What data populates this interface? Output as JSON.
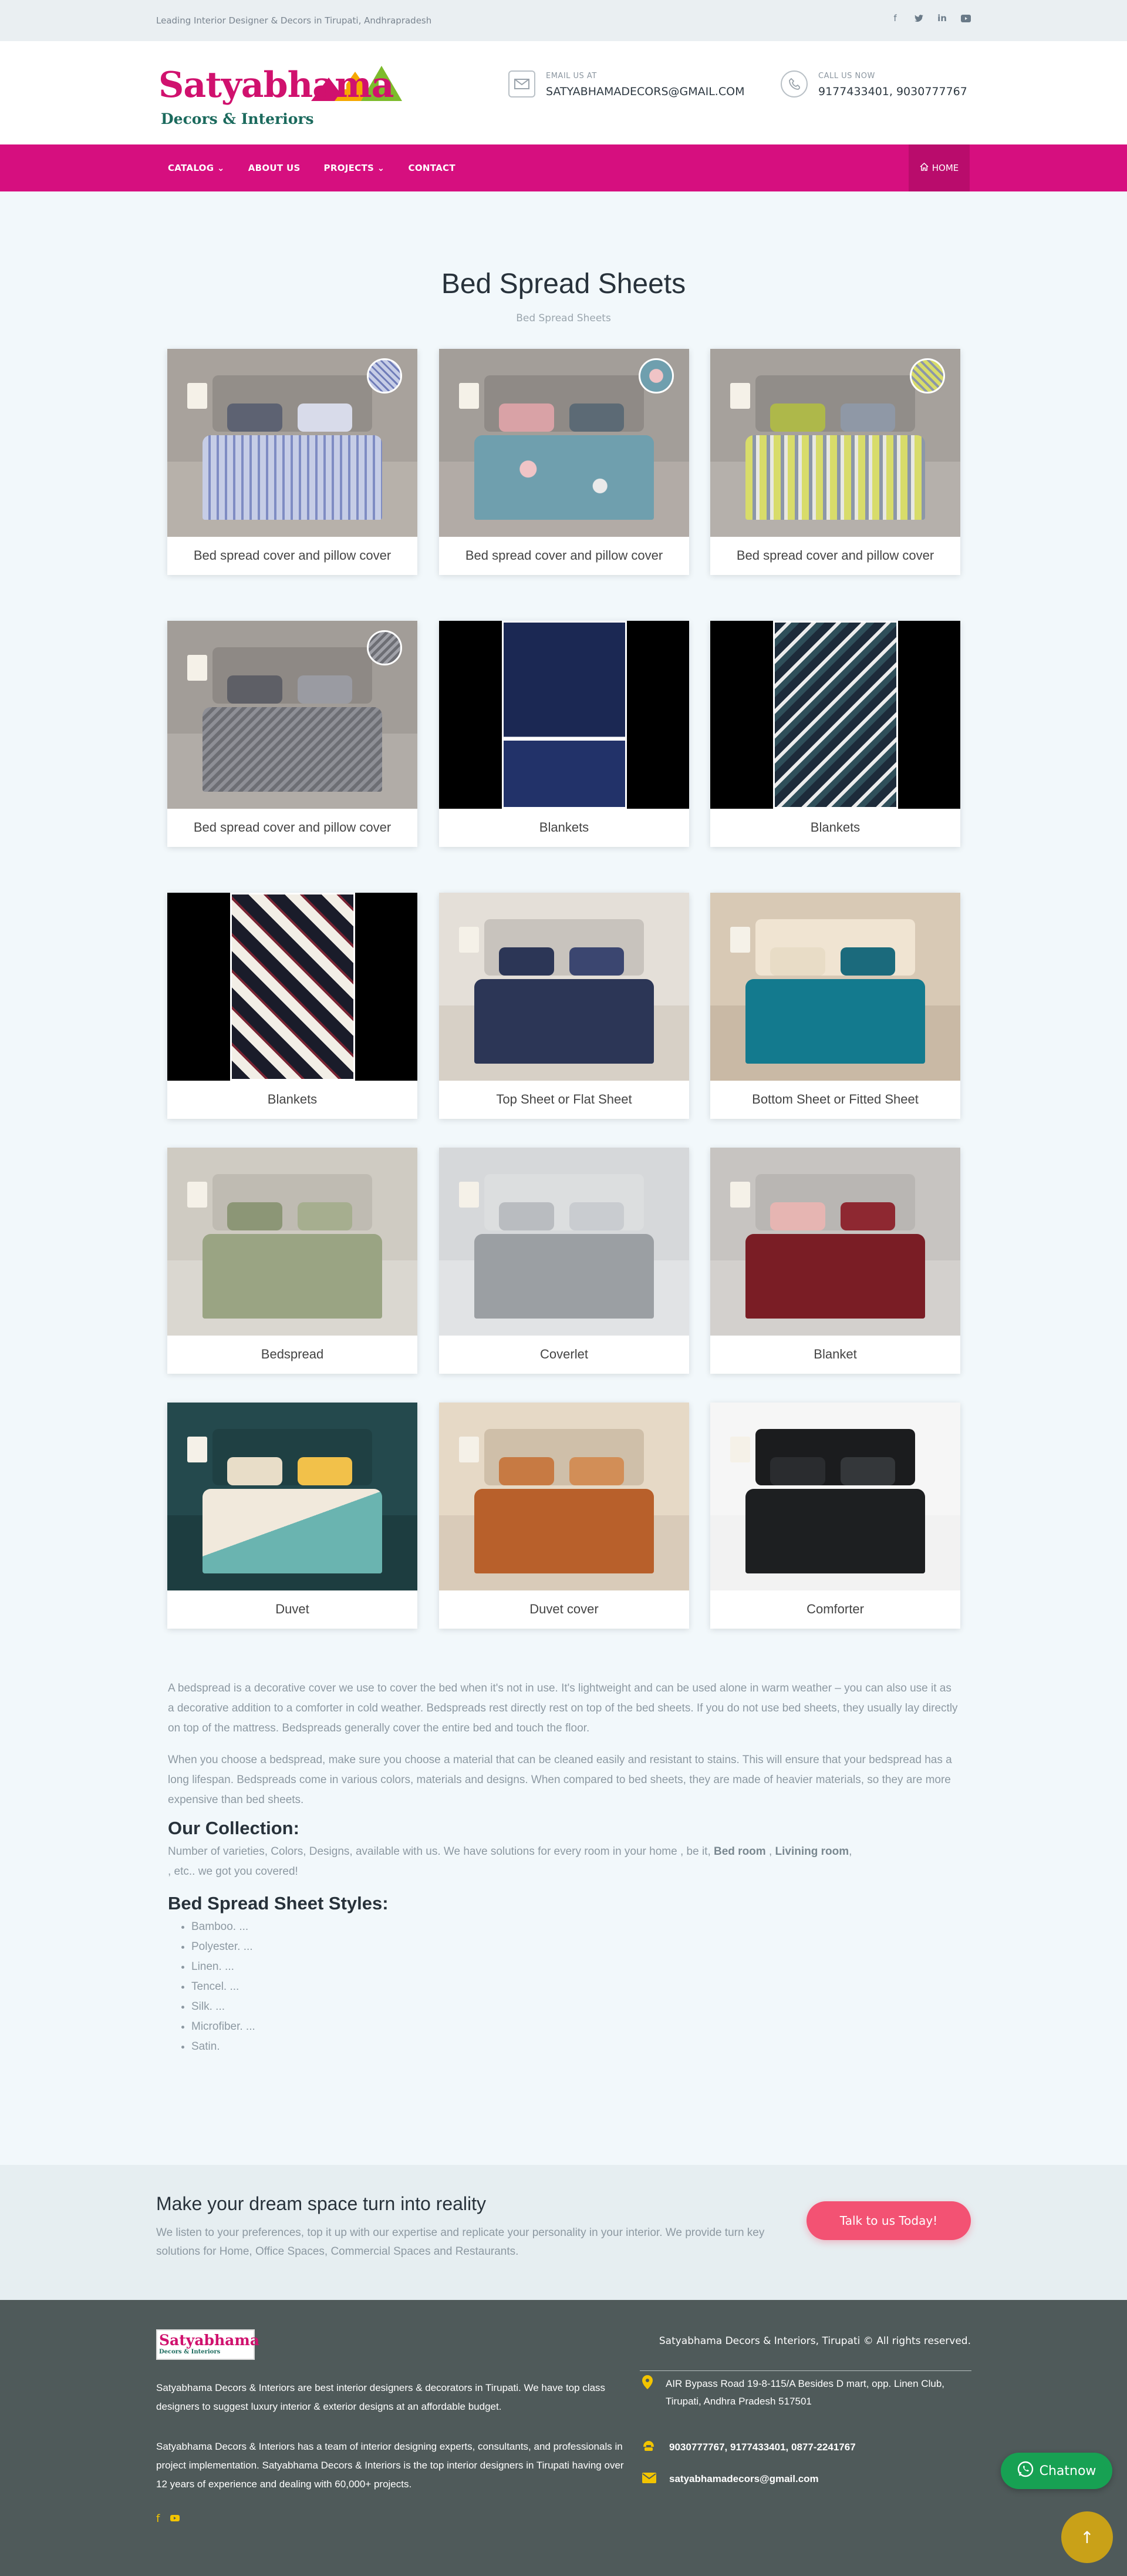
{
  "topbar": {
    "tagline": "Leading Interior Designer & Decors in Tirupati, Andhrapradesh",
    "social": [
      "facebook-icon",
      "twitter-icon",
      "linkedin-icon",
      "youtube-icon"
    ]
  },
  "header": {
    "logo_main": "Satyabhama",
    "logo_sub": "Decors & Interiors",
    "email_label": "EMAIL US AT",
    "email_value": "SATYABHAMADECORS@GMAIL.COM",
    "call_label": "CALL US NOW",
    "call_value": "9177433401, 9030777767"
  },
  "nav": {
    "items": [
      "CATALOG",
      "ABOUT US",
      "PROJECTS",
      "CONTACT"
    ],
    "home_label": "HOME",
    "color": "#d60f7f"
  },
  "page": {
    "title": "Bed Spread Sheets",
    "subtitle": "Bed Spread Sheets"
  },
  "products": [
    {
      "caption": "Bed spread cover and pillow cover",
      "style": "stripe-lilac"
    },
    {
      "caption": "Bed spread cover and pillow cover",
      "style": "floral-blue"
    },
    {
      "caption": "Bed spread cover and pillow cover",
      "style": "stripe-yellow"
    },
    {
      "caption": "Bed spread cover and pillow cover",
      "style": "grey-wave"
    },
    {
      "caption": "Blankets",
      "style": "blanket-navy"
    },
    {
      "caption": "Blankets",
      "style": "blanket-chevron"
    },
    {
      "caption": "Blankets",
      "style": "blanket-geo"
    },
    {
      "caption": "Top Sheet or Flat Sheet",
      "style": "flat-navy"
    },
    {
      "caption": "Bottom Sheet or Fitted Sheet",
      "style": "fitted-teal"
    },
    {
      "caption": "Bedspread",
      "style": "bedspread-olive"
    },
    {
      "caption": "Coverlet",
      "style": "coverlet-grey"
    },
    {
      "caption": "Blanket",
      "style": "blanket-maroon"
    },
    {
      "caption": "Duvet",
      "style": "duvet-teal"
    },
    {
      "caption": "Duvet cover",
      "style": "duvet-rust"
    },
    {
      "caption": "Comforter",
      "style": "comforter-black"
    }
  ],
  "description": {
    "para1": "A bedspread is a decorative cover we use to cover the bed when it's not in use. It's lightweight and can be used alone in warm weather – you can also use it as a decorative addition to a comforter in cold weather. Bedspreads rest directly rest on top of the bed sheets. If you do not use bed sheets, they usually lay directly on top of the mattress. Bedspreads generally cover the entire bed and touch the floor.",
    "para2": "When you choose a bedspread, make sure you choose a material that can be cleaned easily and resistant to stains. This will ensure that your bedspread has a long lifespan. Bedspreads come in various colors, materials and designs. When compared to bed sheets, they are made of heavier materials, so they are more expensive than bed sheets.",
    "collection_heading": "Our Collection:",
    "collection_text_a": " Number of varieties, Colors, Designs,  available with us. We have solutions for every room in your home , be it, ",
    "collection_bold_1": "Bed room",
    "collection_sep": " , ",
    "collection_bold_2": "Livining  room",
    "collection_text_b": ",",
    "collection_text_c": ",  etc.. we got you covered!",
    "styles_heading": "Bed Spread Sheet Styles:",
    "styles": [
      "Bamboo. ...",
      "Polyester. ...",
      "Linen. ...",
      "Tencel. ...",
      "Silk. ...",
      "Microfiber. ...",
      "Satin."
    ]
  },
  "cta": {
    "heading": "Make your dream space turn into reality",
    "text": "We listen to your preferences, top it up with our expertise and replicate your personality in your interior. We provide turn key solutions for Home, Office Spaces, Commercial Spaces and Restaurants.",
    "button": "Talk to us Today!"
  },
  "footer": {
    "copyright": "Satyabhama Decors & Interiors, Tirupati © All rights reserved.",
    "about1": "Satyabhama Decors & Interiors are best interior designers & decorators in Tirupati. We have top class designers to suggest luxury interior & exterior designs at an affordable budget.",
    "about2": "Satyabhama Decors & Interiors has a team of interior designing experts, consultants, and professionals in project implementation. Satyabhama Decors & Interiors is the top interior designers in Tirupati having over 12 years of experience and dealing with 60,000+ projects.",
    "address": "AIR Bypass Road 19-8-115/A Besides D mart, opp. Linen Club, Tirupati, Andhra Pradesh 517501",
    "phones": "9030777767, 9177433401, 0877-2241767",
    "email": "satyabhamadecors@gmail.com",
    "chat_label": "Chatnow",
    "accent": "#f2c400"
  }
}
